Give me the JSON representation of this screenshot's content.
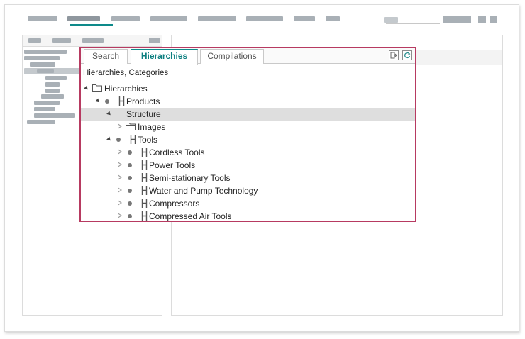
{
  "widget": {
    "tabs": [
      {
        "label": "Search",
        "active": false
      },
      {
        "label": "Hierarchies",
        "active": true
      },
      {
        "label": "Compilations",
        "active": false
      }
    ],
    "subtitle": "Hierarchies, Categories",
    "accent_color": "#0d8a8a",
    "highlight_border_color": "#b73a61",
    "tool_icons": [
      "export-icon",
      "refresh-icon"
    ]
  },
  "tree": {
    "root": "Hierarchies",
    "products": "Products",
    "structure": "Structure",
    "images": "Images",
    "tools": "Tools",
    "tool_children": [
      "Cordless Tools",
      "Power Tools",
      "Semi-stationary Tools",
      "Water and Pump Technology",
      "Compressors",
      "Compressed Air Tools"
    ]
  }
}
